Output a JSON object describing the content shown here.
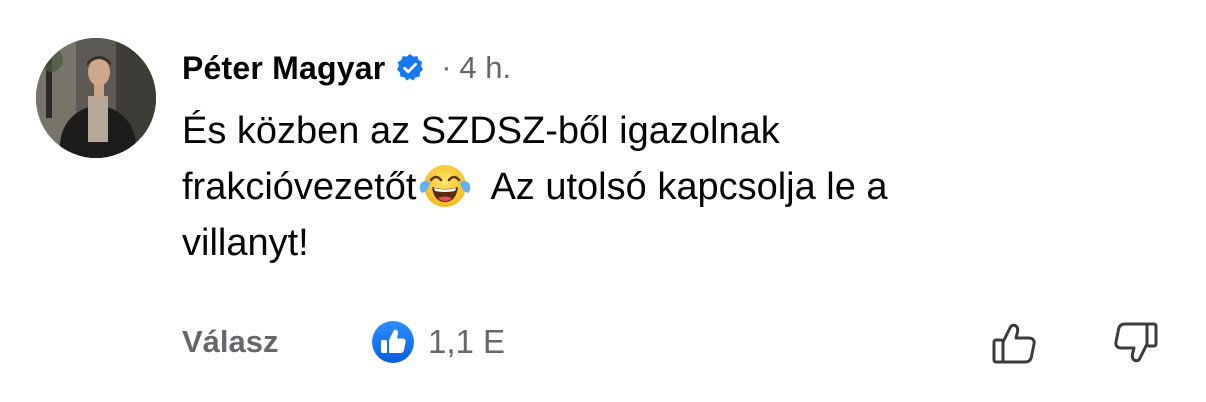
{
  "comment": {
    "author": "Péter Magyar",
    "verified_icon": "verified-badge-icon",
    "separator": "·",
    "time": "4 h.",
    "text_line1": "És közben az SZDSZ-ből igazolnak",
    "text_line2a": "frakcióvezetőt",
    "emoji": "face-with-tears-of-joy",
    "text_line2b": "Az utolsó kapcsolja le a",
    "text_line3": "villanyt!"
  },
  "actions": {
    "reply_label": "Válasz",
    "reaction_icon": "like-reaction-icon",
    "reaction_count": "1,1 E",
    "upvote_icon": "thumbs-up-outline-icon",
    "downvote_icon": "thumbs-down-outline-icon"
  },
  "colors": {
    "text": "#050505",
    "secondary": "#65676b",
    "accent": "#1877f2"
  }
}
